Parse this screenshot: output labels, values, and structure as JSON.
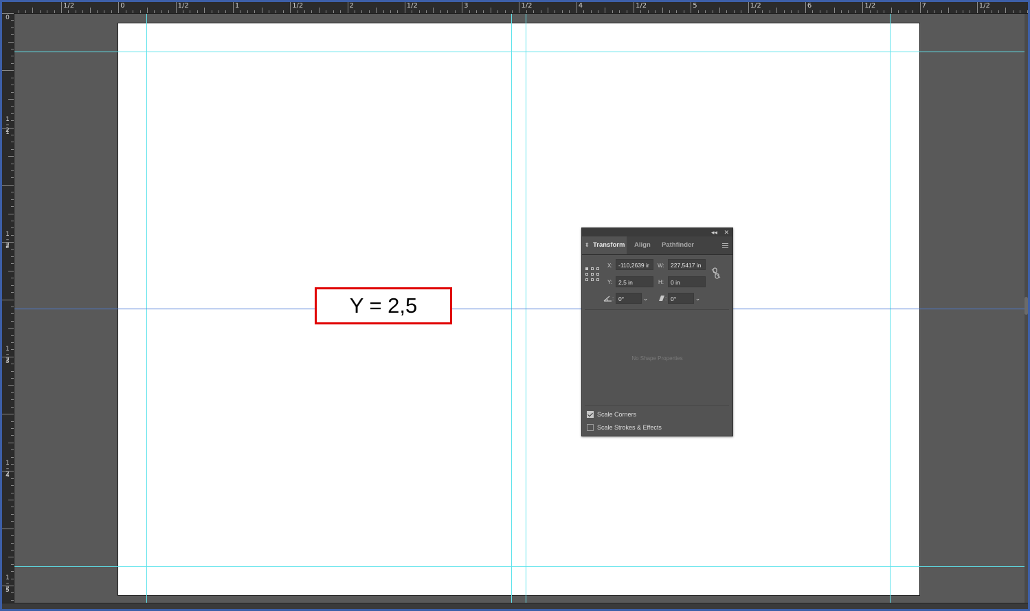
{
  "rulers": {
    "horizontal_labels": [
      "1/2",
      "0",
      "1/2",
      "1",
      "1/2",
      "2",
      "1/2",
      "3",
      "1/2",
      "4",
      "1/2",
      "5",
      "1/2",
      "6",
      "1/2",
      "7",
      "1/2"
    ],
    "vertical_labels": [
      "0",
      "1/2",
      "1",
      "1/2",
      "2",
      "1/2",
      "3",
      "1/2",
      "4",
      "1/2",
      "5"
    ]
  },
  "callout": {
    "text": "Y = 2,5",
    "border_color": "#e00000"
  },
  "guides": {
    "color": "#5fe3ec",
    "selected_path_color": "#4d7bd6"
  },
  "transform_panel": {
    "controls": {
      "collapse_icon": "double-chevron-left-icon",
      "close_icon": "close-icon"
    },
    "tabs": [
      "Transform",
      "Align",
      "Pathfinder"
    ],
    "active_tab": "Transform",
    "x": {
      "label": "X:",
      "value": "-110,2639 ir"
    },
    "y": {
      "label": "Y:",
      "value": "2,5 in"
    },
    "w": {
      "label": "W:",
      "value": "227,5417 in"
    },
    "h": {
      "label": "H:",
      "value": "0 in"
    },
    "rotate": {
      "icon": "rotate-angle-icon",
      "value": "0°"
    },
    "shear": {
      "icon": "shear-icon",
      "value": "0°"
    },
    "no_shape_text": "No Shape Properties",
    "scale_corners": {
      "label": "Scale Corners",
      "checked": true
    },
    "scale_strokes": {
      "label": "Scale Strokes & Effects",
      "checked": false
    }
  }
}
